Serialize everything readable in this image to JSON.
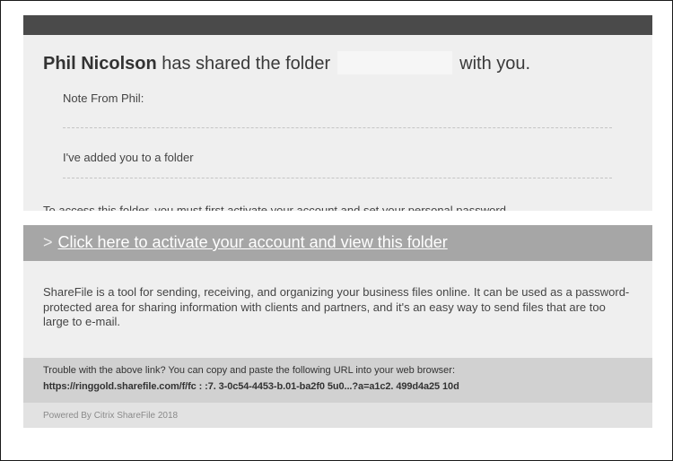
{
  "email": {
    "sender_name": "Phil Nicolson",
    "headline_mid": "has shared the folder",
    "headline_end": "with you.",
    "note_label": "Note From Phil:",
    "note_text": "I've added you to a folder",
    "access_text": "To access this folder, you must first activate your account and set your personal password.",
    "cta_chevron": ">",
    "cta_link": "Click here to activate your account and view this folder",
    "about_text": "ShareFile is a tool for sending, receiving, and organizing your business files online. It can be used as a password-protected area for sharing information with clients and partners, and it's an easy way to send files that are too large to e-mail.",
    "trouble_text": "Trouble with the above link? You can copy and paste the following URL into your web browser:",
    "trouble_url": "https://ringgold.sharefile.com/f/fc : :7. 3-0c54-4453-b.01-ba2f0 5u0...?a=a1c2. 499d4a25 10d",
    "powered_by": "Powered By Citrix ShareFile 2018"
  },
  "colors": {
    "topbar": "#4a4a4a",
    "panel": "#efefef",
    "cta_bar": "#a6a6a6",
    "trouble_bar": "#d1d1d1",
    "footer_bar": "#e2e2e2"
  }
}
